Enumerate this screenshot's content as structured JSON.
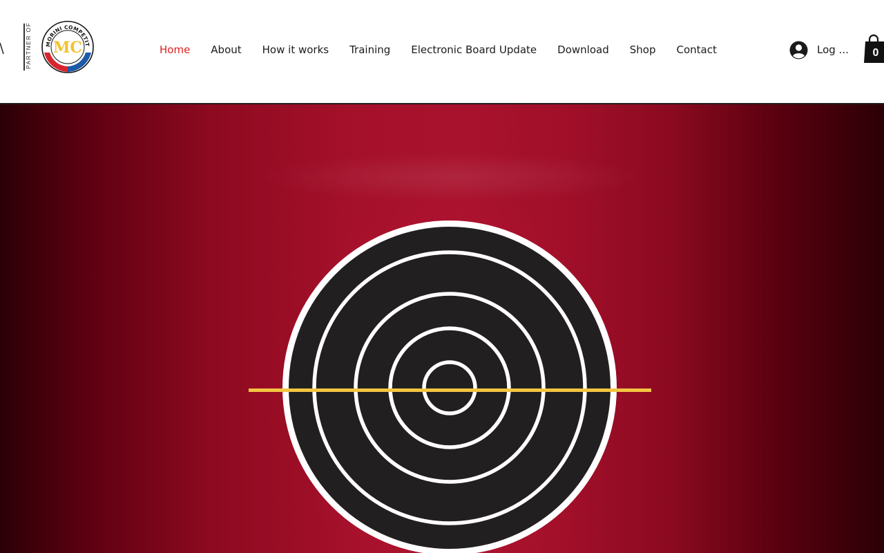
{
  "header": {
    "partner_text": "PARTNER OF",
    "logo_ring_text": "MORINI COMPETITION ARM SA",
    "logo_monogram": "MC",
    "logo_colors": {
      "gold": "#f2c22f",
      "red": "#d7262e",
      "blue": "#1d5aa8",
      "ink": "#111111"
    }
  },
  "nav": {
    "items": [
      {
        "label": "Home",
        "active": true
      },
      {
        "label": "About",
        "active": false
      },
      {
        "label": "How it works",
        "active": false
      },
      {
        "label": "Training",
        "active": false
      },
      {
        "label": "Electronic Board Update",
        "active": false
      },
      {
        "label": "Download",
        "active": false
      },
      {
        "label": "Shop",
        "active": false
      },
      {
        "label": "Contact",
        "active": false
      }
    ],
    "active_color": "#e21c1c"
  },
  "account": {
    "login_label": "Log ...",
    "icon": "user-avatar-icon"
  },
  "cart": {
    "count": "0",
    "icon": "shopping-bag-icon"
  },
  "hero": {
    "background_color": "#a5102a",
    "target_color": "#221f20",
    "ring_color": "#ffffff",
    "line_color": "#f4c542"
  }
}
